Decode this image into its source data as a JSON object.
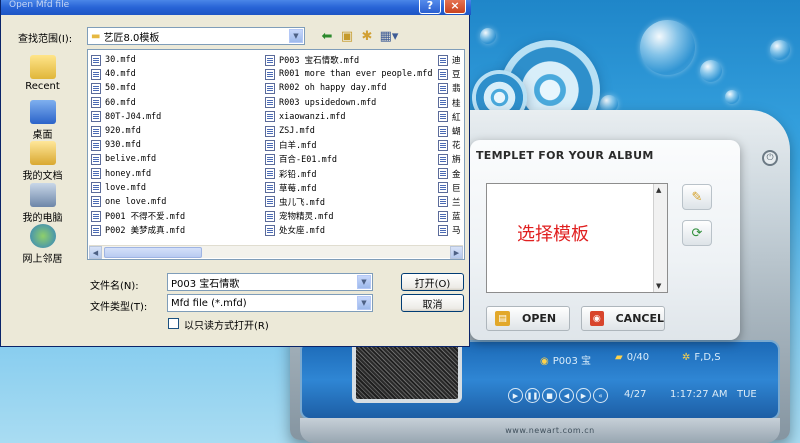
{
  "file_dialog": {
    "title": "Open Mfd file",
    "help_button": "?",
    "close_button": "×",
    "look_in_label": "查找范围(I):",
    "look_in_value": "艺匠8.0模板",
    "places": [
      {
        "label": "Recent",
        "icon": "recent-folder-icon"
      },
      {
        "label": "桌面",
        "icon": "desktop-icon"
      },
      {
        "label": "我的文档",
        "icon": "my-documents-icon"
      },
      {
        "label": "我的电脑",
        "icon": "my-computer-icon"
      },
      {
        "label": "网上邻居",
        "icon": "network-icon"
      }
    ],
    "files_col1": [
      "30.mfd",
      "40.mfd",
      "50.mfd",
      "60.mfd",
      "80T-J04.mfd",
      "920.mfd",
      "930.mfd",
      "belive.mfd",
      "honey.mfd",
      "love.mfd",
      "one love.mfd",
      "P001 不得不爱.mfd",
      "P002 美梦成真.mfd"
    ],
    "files_col2": [
      "P003 宝石情歌.mfd",
      "R001 more than ever people.mfd",
      "R002 oh happy day.mfd",
      "R003 upsidedown.mfd",
      "xiaowanzi.mfd",
      "ZSJ.mfd",
      "白羊.mfd",
      "百合-E01.mfd",
      "彩铅.mfd",
      "草莓.mfd",
      "虫儿飞.mfd",
      "宠物精灵.mfd",
      "处女座.mfd"
    ],
    "files_col3": [
      "迪",
      "豆",
      "翡",
      "桂",
      "紅",
      "蝴",
      "花",
      "旃",
      "金",
      "巨",
      "兰",
      "蓝",
      "马"
    ],
    "filename_label": "文件名(N):",
    "filename_value": "P003 宝石情歌",
    "filetype_label": "文件类型(T):",
    "filetype_value": "Mfd file (*.mfd)",
    "open_button": "打开(O)",
    "cancel_button": "取消",
    "readonly_label": "以只读方式打开(R)"
  },
  "template_dialog": {
    "title": "TEMPLET FOR YOUR ALBUM",
    "list_placeholder": "选择模板",
    "open_button": "OPEN",
    "cancel_button": "CANCEL"
  },
  "player": {
    "track": "P003 宝",
    "count": "0/40",
    "mode": "F,D,S",
    "date": "4/27",
    "time": "1:17:27",
    "period": "AM",
    "weekday": "TUE",
    "website": "www.newart.com.cn"
  },
  "colors": {
    "titlebar": "#2763d6",
    "dialog_bg": "#ece9d8",
    "accent_red": "#e02020"
  }
}
